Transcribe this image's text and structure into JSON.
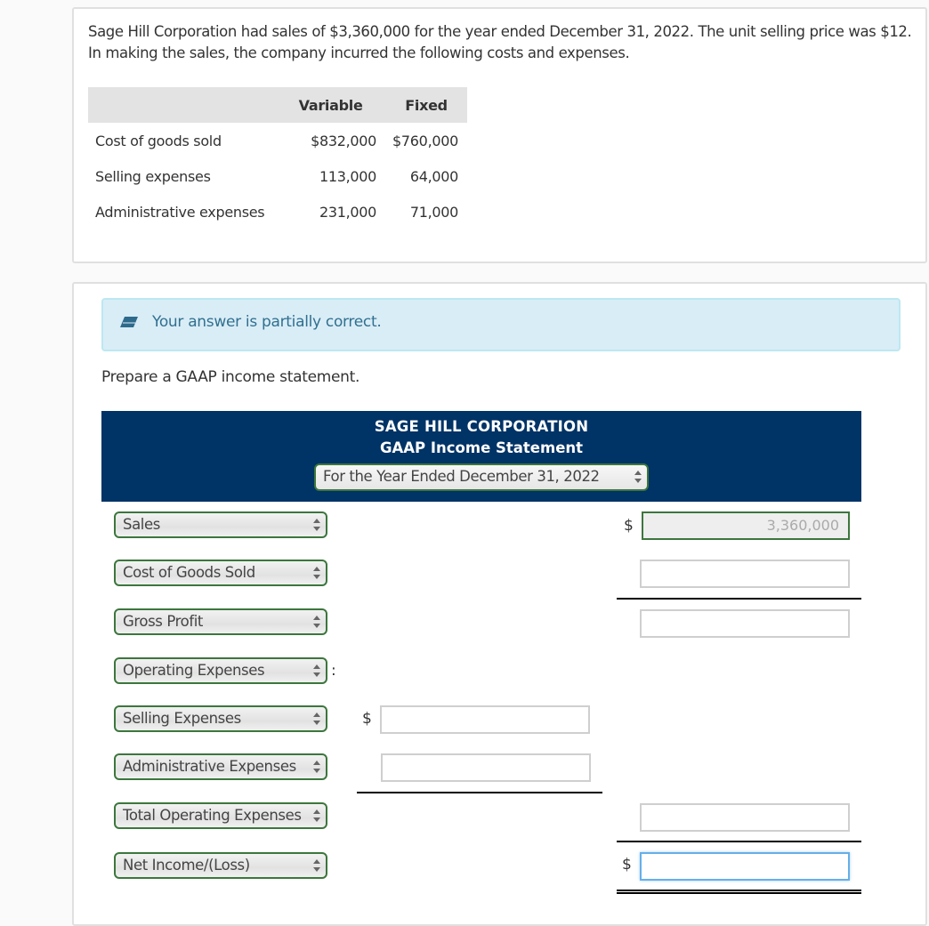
{
  "problem": {
    "intro": "Sage Hill Corporation had sales of $3,360,000 for the year ended December 31, 2022. The unit selling price was $12. In making the sales, the company incurred the following costs and expenses.",
    "table": {
      "headers": [
        "",
        "Variable",
        "Fixed"
      ],
      "rows": [
        {
          "label": "Cost of goods sold",
          "variable": "$832,000",
          "fixed": "$760,000"
        },
        {
          "label": "Selling expenses",
          "variable": "113,000",
          "fixed": "64,000"
        },
        {
          "label": "Administrative expenses",
          "variable": "231,000",
          "fixed": "71,000"
        }
      ]
    }
  },
  "feedback": {
    "icon": "eraser-icon",
    "text": "Your answer is partially correct.",
    "color": "#31708f"
  },
  "prompt": "Prepare a GAAP income statement.",
  "statement": {
    "company": "SAGE HILL CORPORATION",
    "title": "GAAP Income Statement",
    "period": "For the Year Ended December 31, 2022",
    "header_color": "#003366",
    "currency_symbol": "$",
    "rows": [
      {
        "label": "Sales",
        "value": "3,360,000"
      },
      {
        "label": "Cost of Goods Sold",
        "value": ""
      },
      {
        "label": "Gross Profit",
        "value": ""
      },
      {
        "label": "Operating Expenses",
        "suffix": ":"
      },
      {
        "label": "Selling Expenses",
        "value": ""
      },
      {
        "label": "Administrative Expenses",
        "value": ""
      },
      {
        "label": "Total Operating Expenses",
        "value": ""
      },
      {
        "label": "Net Income/(Loss)",
        "value": ""
      }
    ]
  }
}
